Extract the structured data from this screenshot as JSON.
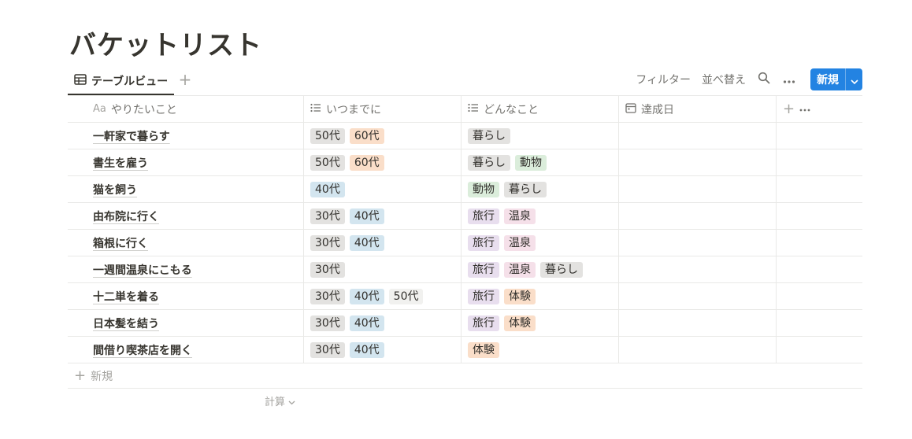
{
  "page": {
    "title": "バケットリスト"
  },
  "view": {
    "tab_label": "テーブルビュー",
    "filter_label": "フィルター",
    "sort_label": "並べ替え",
    "new_label": "新規"
  },
  "table": {
    "headers": {
      "name_prefix": "Aa",
      "name": "やりたいこと",
      "when": "いつまでに",
      "what": "どんなこと",
      "date": "達成日"
    },
    "rows": [
      {
        "name": "一軒家で暮らす",
        "when": [
          "50代",
          "60代"
        ],
        "what": [
          "暮らし"
        ],
        "date": ""
      },
      {
        "name": "書生を雇う",
        "when": [
          "50代",
          "60代"
        ],
        "what": [
          "暮らし",
          "動物"
        ],
        "date": ""
      },
      {
        "name": "猫を飼う",
        "when": [
          "40代"
        ],
        "what": [
          "動物",
          "暮らし"
        ],
        "date": ""
      },
      {
        "name": "由布院に行く",
        "when": [
          "30代",
          "40代"
        ],
        "what": [
          "旅行",
          "温泉"
        ],
        "date": ""
      },
      {
        "name": "箱根に行く",
        "when": [
          "30代",
          "40代"
        ],
        "what": [
          "旅行",
          "温泉"
        ],
        "date": ""
      },
      {
        "name": "一週間温泉にこもる",
        "when": [
          "30代"
        ],
        "what": [
          "旅行",
          "温泉",
          "暮らし"
        ],
        "date": ""
      },
      {
        "name": "十二単を着る",
        "when": [
          "30代",
          "40代",
          "50代"
        ],
        "what": [
          "旅行",
          "体験"
        ],
        "date": ""
      },
      {
        "name": "日本髪を結う",
        "when": [
          "30代",
          "40代"
        ],
        "what": [
          "旅行",
          "体験"
        ],
        "date": ""
      },
      {
        "name": "間借り喫茶店を開く",
        "when": [
          "30代",
          "40代"
        ],
        "what": [
          "体験"
        ],
        "date": ""
      }
    ],
    "new_row_label": "新規",
    "calc_label": "計算"
  },
  "tag_colors": {
    "30代": "gray",
    "40代": "blue",
    "50代": "gray",
    "60代": "orange",
    "暮らし": "gray",
    "動物": "green",
    "旅行": "purple",
    "温泉": "pink",
    "体験": "orange"
  },
  "tag_color_overrides": {
    "6.when.2": "default"
  },
  "colors": {
    "accent": "#2383e2",
    "text": "#37352f",
    "muted": "#73726e",
    "border": "#e9e9e7"
  },
  "icons": {
    "tab": "table-icon",
    "add_view": "plus-icon",
    "search": "search-icon",
    "more": "more-horizontal-icon",
    "new_dropdown": "chevron-down-icon",
    "multi_select": "list-icon",
    "date": "calendar-icon",
    "add_column": "plus-icon",
    "calc": "chevron-down-icon"
  }
}
